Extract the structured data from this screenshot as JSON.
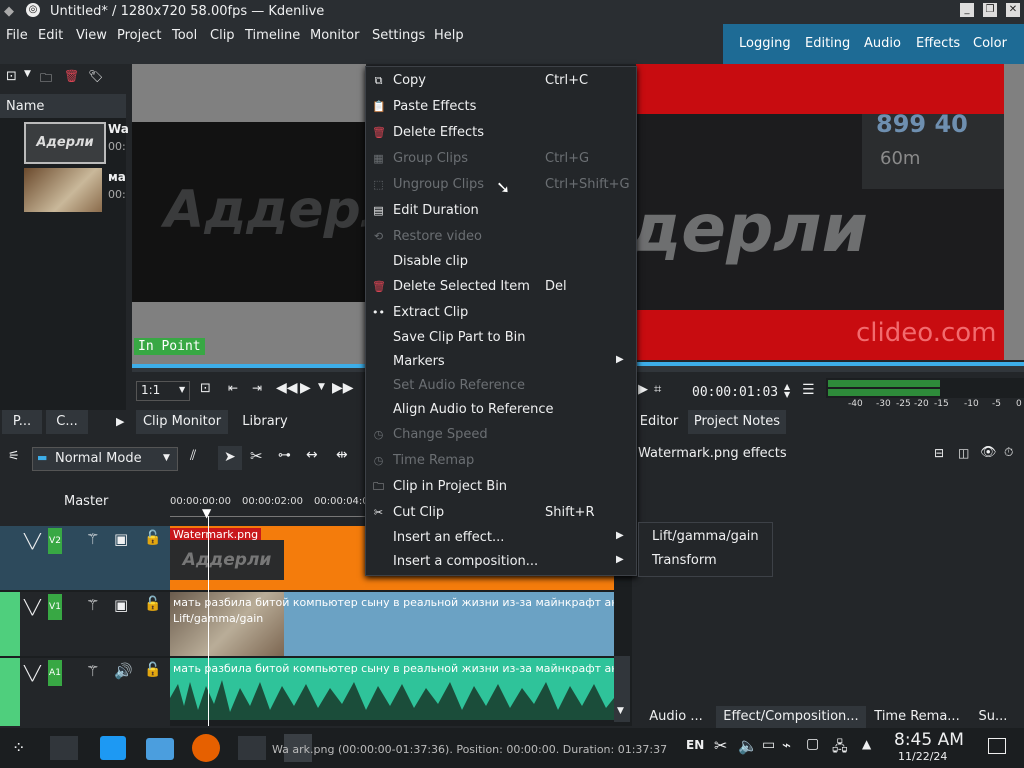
{
  "window": {
    "title": "Untitled* / 1280x720 58.00fps — Kdenlive"
  },
  "menubar": [
    "File",
    "Edit",
    "View",
    "Project",
    "Tool",
    "Clip",
    "Timeline",
    "Monitor",
    "Settings",
    "Help"
  ],
  "workspaces": [
    "Logging",
    "Editing",
    "Audio",
    "Effects",
    "Color"
  ],
  "bin": {
    "column_name": "Name",
    "items": [
      {
        "name": "Wa",
        "time": "00:",
        "thumb_text": "Адерли"
      },
      {
        "name": "ма",
        "time": "00:"
      }
    ]
  },
  "clip_monitor": {
    "overlay_text": "Аддерли",
    "in_point": "In Point",
    "zoom": "1:1"
  },
  "project_monitor": {
    "line1": "899 40",
    "line2": "60m",
    "overlay_text": "дерли",
    "watermark": "clideo.com",
    "timecode": "00:00:01:03"
  },
  "vu_scale": [
    "-40",
    "-30",
    "-25",
    "-20",
    "-15",
    "-10",
    "-5",
    "0"
  ],
  "tabs_left": [
    "P...",
    "C...",
    "Clip Monitor",
    "Library"
  ],
  "tabs_right": [
    "Editor",
    "Project Notes"
  ],
  "effects_panel": {
    "title": "Watermark.png effects"
  },
  "timeline": {
    "mode": "Normal Mode",
    "master": "Master",
    "ruler": [
      "00:00:00:00",
      "00:00:02:00",
      "00:00:04:0"
    ],
    "tracks": [
      {
        "name": "V2",
        "clip_title": "Watermark.png",
        "thumb_text": "Аддерли"
      },
      {
        "name": "V1",
        "clip_title": "мать разбила битой компьютер сыну в реальной жизни из-за майнкрафт анти-гр",
        "effect": "Lift/gamma/gain"
      },
      {
        "name": "A1",
        "clip_title": "мать разбила битой компьютер сыну в реальной жизни из-за майнкрафт анти-гр"
      }
    ]
  },
  "bottom_tabs": [
    "Audio ...",
    "Effect/Composition...",
    "Time Rema...",
    "Su..."
  ],
  "context_menu": [
    {
      "label": "Copy",
      "shortcut": "Ctrl+C",
      "icon": "copy-icon"
    },
    {
      "label": "Paste Effects",
      "icon": "paste-icon"
    },
    {
      "label": "Delete Effects",
      "icon": "trash-icon"
    },
    {
      "label": "Group Clips",
      "shortcut": "Ctrl+G",
      "disabled": true,
      "icon": "group-icon"
    },
    {
      "label": "Ungroup Clips",
      "shortcut": "Ctrl+Shift+G",
      "disabled": true,
      "icon": "ungroup-icon"
    },
    {
      "label": "Edit Duration",
      "icon": "duration-icon"
    },
    {
      "label": "Restore video",
      "disabled": true,
      "icon": "restore-icon"
    },
    {
      "label": "Disable clip"
    },
    {
      "label": "Delete Selected Item",
      "shortcut": "Del",
      "icon": "trash-icon"
    },
    {
      "label": "Extract Clip",
      "icon": "extract-icon"
    },
    {
      "label": "Save Clip Part to Bin"
    },
    {
      "label": "Markers",
      "submenu": true
    },
    {
      "label": "Set Audio Reference",
      "disabled": true
    },
    {
      "label": "Align Audio to Reference"
    },
    {
      "label": "Change Speed",
      "disabled": true,
      "icon": "speed-icon"
    },
    {
      "label": "Time Remap",
      "disabled": true,
      "icon": "time-remap-icon"
    },
    {
      "label": "Clip in Project Bin",
      "icon": "bin-icon"
    },
    {
      "label": "Cut Clip",
      "shortcut": "Shift+R",
      "icon": "scissors-icon"
    },
    {
      "label": "Insert an effect...",
      "submenu": true
    },
    {
      "label": "Insert a composition...",
      "submenu": true
    }
  ],
  "submenu": [
    "Lift/gamma/gain",
    "Transform"
  ],
  "taskbar": {
    "status": "Wa    ark.png (00:00:00-01:37:36). Position: 00:00:00. Duration: 01:37:37",
    "lang": "EN",
    "time": "8:45 AM",
    "date": "11/22/24"
  },
  "colors": {
    "accent": "#3daee9",
    "workspace_bar": "#1e6b95",
    "v2_clip": "#f47c0c",
    "v1_clip": "#6ba2c4",
    "a1_clip": "#2fc39a",
    "clip_title": "#c8171b"
  }
}
